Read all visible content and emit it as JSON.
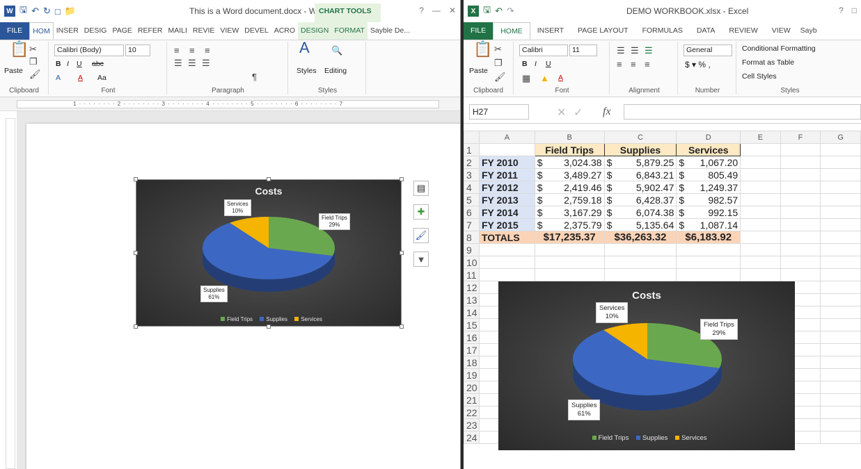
{
  "word": {
    "title": "This is a Word document.docx - Word",
    "context_tab": "CHART TOOLS",
    "tabs": [
      "FILE",
      "HOM",
      "INSER",
      "DESIG",
      "PAGE",
      "REFER",
      "MAILI",
      "REVIE",
      "VIEW",
      "DEVEL",
      "ACRO",
      "DESIGN",
      "FORMAT"
    ],
    "user": "Sayble De...",
    "font_name": "Calibri (Body)",
    "font_size": "10",
    "paste_label": "Paste",
    "styles_label": "Styles",
    "editing_label": "Editing",
    "groups": [
      "Clipboard",
      "Font",
      "Paragraph",
      "Styles"
    ],
    "ruler_marks": "1 · · · · · · · · 2 · · · · · · · · 3 · · · · · · · · 4 · · · · · · · · 5 · · · · · · · · 6 · · · · · · · · 7"
  },
  "excel": {
    "title": "DEMO WORKBOOK.xlsx - Excel",
    "tabs": [
      "FILE",
      "HOME",
      "INSERT",
      "PAGE LAYOUT",
      "FORMULAS",
      "DATA",
      "REVIEW",
      "VIEW",
      "Sayb"
    ],
    "font_name": "Calibri",
    "font_size": "11",
    "number_format": "General",
    "cond_format": "Conditional Formatting",
    "format_table": "Format as Table",
    "cell_styles": "Cell Styles",
    "paste_label": "Paste",
    "groups": [
      "Clipboard",
      "Font",
      "Alignment",
      "Number",
      "Styles"
    ],
    "name_box": "H27",
    "columns": [
      "A",
      "B",
      "C",
      "D",
      "E",
      "F",
      "G"
    ],
    "headers": [
      "Field Trips",
      "Supplies",
      "Services"
    ],
    "rows": [
      {
        "year": "FY 2010",
        "b": "3,024.38",
        "c": "5,879.25",
        "d": "1,067.20"
      },
      {
        "year": "FY 2011",
        "b": "3,489.27",
        "c": "6,843.21",
        "d": "805.49"
      },
      {
        "year": "FY 2012",
        "b": "2,419.46",
        "c": "5,902.47",
        "d": "1,249.37"
      },
      {
        "year": "FY 2013",
        "b": "2,759.18",
        "c": "6,428.37",
        "d": "982.57"
      },
      {
        "year": "FY 2014",
        "b": "3,167.29",
        "c": "6,074.38",
        "d": "992.15"
      },
      {
        "year": "FY 2015",
        "b": "2,375.79",
        "c": "5,135.64",
        "d": "1,087.14"
      }
    ],
    "totals": {
      "label": "TOTALS",
      "b": "$17,235.37",
      "c": "$36,263.32",
      "d": "$6,183.92"
    },
    "currency": "$",
    "row_numbers": [
      "1",
      "2",
      "3",
      "4",
      "5",
      "6",
      "7",
      "8",
      "9",
      "10",
      "11",
      "12",
      "13",
      "14",
      "15",
      "16",
      "17",
      "18",
      "19",
      "20",
      "21",
      "22",
      "23",
      "24"
    ]
  },
  "chart_data": [
    {
      "type": "pie",
      "title": "Costs",
      "categories": [
        "Field Trips",
        "Supplies",
        "Services"
      ],
      "values": [
        29,
        61,
        10
      ],
      "labels": [
        "Field Trips\n29%",
        "Supplies\n61%",
        "Services\n10%"
      ],
      "colors": [
        "#6aa84f",
        "#3c68c4",
        "#f4b400"
      ]
    },
    {
      "type": "pie",
      "title": "Costs",
      "categories": [
        "Field Trips",
        "Supplies",
        "Services"
      ],
      "values": [
        29,
        61,
        10
      ],
      "labels": [
        "Field Trips\n29%",
        "Supplies\n61%",
        "Services\n10%"
      ],
      "colors": [
        "#6aa84f",
        "#3c68c4",
        "#f4b400"
      ]
    }
  ],
  "chart_text": {
    "title": "Costs",
    "field_trips_name": "Field Trips",
    "field_trips_pct": "29%",
    "supplies_name": "Supplies",
    "supplies_pct": "61%",
    "services_name": "Services",
    "services_pct": "10%"
  },
  "colors": {
    "word_blue": "#2b579a",
    "excel_green": "#217346"
  }
}
